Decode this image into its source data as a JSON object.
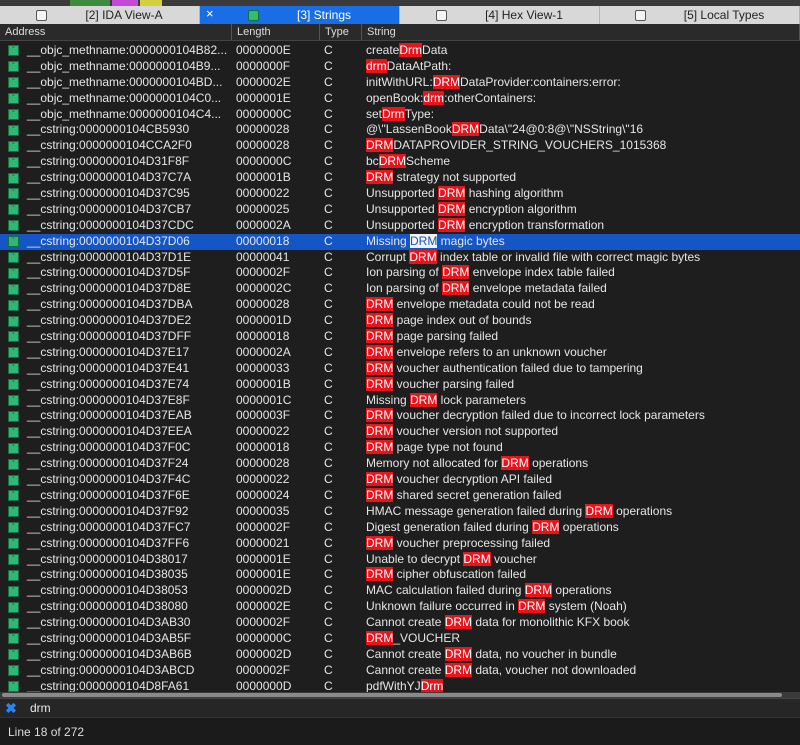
{
  "tabs": [
    {
      "label": "[2] IDA View-A",
      "active": false
    },
    {
      "label": "[3] Strings",
      "active": true
    },
    {
      "label": "[4] Hex View-1",
      "active": false
    },
    {
      "label": "[5] Local Types",
      "active": false
    }
  ],
  "columns": [
    "Address",
    "Length",
    "Type",
    "String"
  ],
  "rows": [
    {
      "addr": "__objc_methname:0000000104B82...",
      "len": "0000000E",
      "type": "C",
      "str": "createDrmData"
    },
    {
      "addr": "__objc_methname:0000000104B9...",
      "len": "0000000F",
      "type": "C",
      "str": "drmDataAtPath:"
    },
    {
      "addr": "__objc_methname:0000000104BD...",
      "len": "0000002E",
      "type": "C",
      "str": "initWithURL:DRMDataProvider:containers:error:"
    },
    {
      "addr": "__objc_methname:0000000104C0...",
      "len": "0000001E",
      "type": "C",
      "str": "openBook:drm:otherContainers:"
    },
    {
      "addr": "__objc_methname:0000000104C4...",
      "len": "0000000C",
      "type": "C",
      "str": "setDrmType:"
    },
    {
      "addr": "__cstring:0000000104CB5930",
      "len": "00000028",
      "type": "C",
      "str": "@\\\"LassenBookDRMData\\\"24@0:8@\\\"NSString\\\"16"
    },
    {
      "addr": "__cstring:0000000104CCA2F0",
      "len": "00000028",
      "type": "C",
      "str": "DRMDATAPROVIDER_STRING_VOUCHERS_1015368"
    },
    {
      "addr": "__cstring:0000000104D31F8F",
      "len": "0000000C",
      "type": "C",
      "str": "bcDRMScheme"
    },
    {
      "addr": "__cstring:0000000104D37C7A",
      "len": "0000001B",
      "type": "C",
      "str": "DRM strategy not supported"
    },
    {
      "addr": "__cstring:0000000104D37C95",
      "len": "00000022",
      "type": "C",
      "str": "Unsupported DRM hashing algorithm"
    },
    {
      "addr": "__cstring:0000000104D37CB7",
      "len": "00000025",
      "type": "C",
      "str": "Unsupported DRM encryption algorithm"
    },
    {
      "addr": "__cstring:0000000104D37CDC",
      "len": "0000002A",
      "type": "C",
      "str": "Unsupported DRM encryption transformation"
    },
    {
      "addr": "__cstring:0000000104D37D06",
      "len": "00000018",
      "type": "C",
      "str": "Missing DRM magic bytes",
      "selected": true
    },
    {
      "addr": "__cstring:0000000104D37D1E",
      "len": "00000041",
      "type": "C",
      "str": "Corrupt DRM index table or invalid file with correct magic bytes"
    },
    {
      "addr": "__cstring:0000000104D37D5F",
      "len": "0000002F",
      "type": "C",
      "str": "Ion parsing of DRM envelope index table failed"
    },
    {
      "addr": "__cstring:0000000104D37D8E",
      "len": "0000002C",
      "type": "C",
      "str": "Ion parsing of DRM envelope metadata failed"
    },
    {
      "addr": "__cstring:0000000104D37DBA",
      "len": "00000028",
      "type": "C",
      "str": "DRM envelope metadata could not be read"
    },
    {
      "addr": "__cstring:0000000104D37DE2",
      "len": "0000001D",
      "type": "C",
      "str": "DRM page index out of bounds"
    },
    {
      "addr": "__cstring:0000000104D37DFF",
      "len": "00000018",
      "type": "C",
      "str": "DRM page parsing failed"
    },
    {
      "addr": "__cstring:0000000104D37E17",
      "len": "0000002A",
      "type": "C",
      "str": "DRM envelope refers to an unknown voucher"
    },
    {
      "addr": "__cstring:0000000104D37E41",
      "len": "00000033",
      "type": "C",
      "str": "DRM voucher authentication failed due to tampering"
    },
    {
      "addr": "__cstring:0000000104D37E74",
      "len": "0000001B",
      "type": "C",
      "str": "DRM voucher parsing failed"
    },
    {
      "addr": "__cstring:0000000104D37E8F",
      "len": "0000001C",
      "type": "C",
      "str": "Missing DRM lock parameters"
    },
    {
      "addr": "__cstring:0000000104D37EAB",
      "len": "0000003F",
      "type": "C",
      "str": "DRM voucher decryption failed due to incorrect lock parameters"
    },
    {
      "addr": "__cstring:0000000104D37EEA",
      "len": "00000022",
      "type": "C",
      "str": "DRM voucher version not supported"
    },
    {
      "addr": "__cstring:0000000104D37F0C",
      "len": "00000018",
      "type": "C",
      "str": "DRM page type not found"
    },
    {
      "addr": "__cstring:0000000104D37F24",
      "len": "00000028",
      "type": "C",
      "str": "Memory not allocated for DRM operations"
    },
    {
      "addr": "__cstring:0000000104D37F4C",
      "len": "00000022",
      "type": "C",
      "str": "DRM voucher decryption API failed"
    },
    {
      "addr": "__cstring:0000000104D37F6E",
      "len": "00000024",
      "type": "C",
      "str": "DRM shared secret generation failed"
    },
    {
      "addr": "__cstring:0000000104D37F92",
      "len": "00000035",
      "type": "C",
      "str": "HMAC message generation failed during DRM operations"
    },
    {
      "addr": "__cstring:0000000104D37FC7",
      "len": "0000002F",
      "type": "C",
      "str": "Digest generation failed during DRM operations"
    },
    {
      "addr": "__cstring:0000000104D37FF6",
      "len": "00000021",
      "type": "C",
      "str": "DRM voucher preprocessing failed"
    },
    {
      "addr": "__cstring:0000000104D38017",
      "len": "0000001E",
      "type": "C",
      "str": "Unable to decrypt DRM voucher"
    },
    {
      "addr": "__cstring:0000000104D38035",
      "len": "0000001E",
      "type": "C",
      "str": "DRM cipher obfuscation failed"
    },
    {
      "addr": "__cstring:0000000104D38053",
      "len": "0000002D",
      "type": "C",
      "str": "MAC calculation failed during DRM operations"
    },
    {
      "addr": "__cstring:0000000104D38080",
      "len": "0000002E",
      "type": "C",
      "str": "Unknown failure occurred in DRM system (Noah)"
    },
    {
      "addr": "__cstring:0000000104D3AB30",
      "len": "0000002F",
      "type": "C",
      "str": "Cannot create DRM data for monolithic KFX book"
    },
    {
      "addr": "__cstring:0000000104D3AB5F",
      "len": "0000000C",
      "type": "C",
      "str": "DRM_VOUCHER"
    },
    {
      "addr": "__cstring:0000000104D3AB6B",
      "len": "0000002D",
      "type": "C",
      "str": "Cannot create DRM data, no voucher in bundle"
    },
    {
      "addr": "__cstring:0000000104D3ABCD",
      "len": "0000002F",
      "type": "C",
      "str": "Cannot create DRM data, voucher not downloaded"
    },
    {
      "addr": "__cstring:0000000104D8FA61",
      "len": "0000000D",
      "type": "C",
      "str": "pdfWithYJDrm"
    }
  ],
  "search": {
    "query": "drm"
  },
  "status": {
    "text": "Line 18 of 272"
  },
  "colors": {
    "highlight": "#e8141c",
    "selection": "#1456c6",
    "active_tab": "#1a6ee5",
    "string_icon": "#2fb874"
  }
}
